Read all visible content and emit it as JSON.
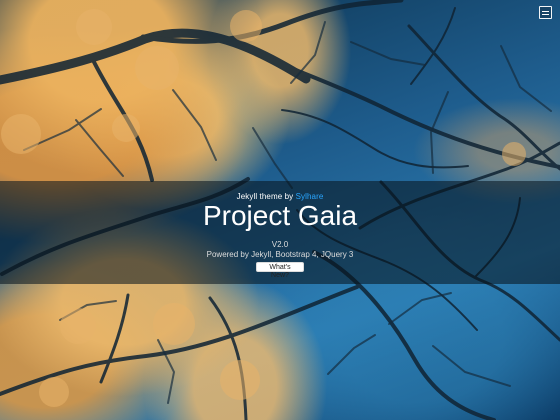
{
  "hero": {
    "theme_prefix": "Jekyll theme by ",
    "author": "Sylhare",
    "title": "Project Gaia",
    "version": "V2.0",
    "powered_by": "Powered by Jekyll, Bootstrap 4, JQuery 3",
    "button_label": "What's New?"
  },
  "nav": {
    "menu_icon": "menu-icon"
  }
}
